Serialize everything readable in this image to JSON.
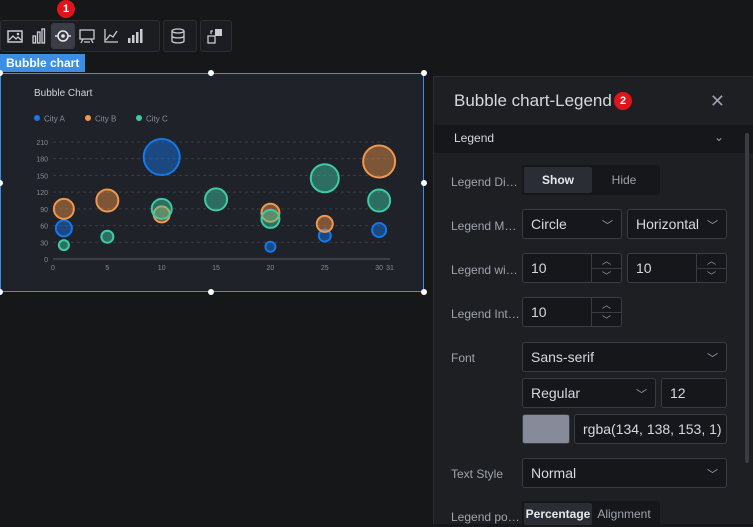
{
  "toolbar": {
    "groups": [
      [
        "image-icon",
        "bar-chart-icon",
        "bubble-target-icon",
        "dashboard-icon",
        "line-axis-icon",
        "rising-bars-icon"
      ],
      [
        "database-icon"
      ],
      [
        "link-transfer-icon"
      ]
    ],
    "active_tool": "bubble-target-icon",
    "badge_1": "1"
  },
  "canvas": {
    "tag_label": "Bubble chart"
  },
  "chart_data": {
    "type": "scatter",
    "title": "Bubble Chart",
    "legend_position": "top-left",
    "xlim": [
      0,
      31
    ],
    "ylim": [
      0,
      210
    ],
    "x_ticks": [
      "0",
      "5",
      "10",
      "15",
      "20",
      "25",
      "30",
      "31"
    ],
    "y_ticks": [
      "0",
      "30",
      "60",
      "90",
      "120",
      "150",
      "180",
      "210"
    ],
    "grid": true,
    "series": [
      {
        "name": "City A",
        "color": "#1677e8",
        "points": [
          [
            1,
            55,
            8
          ],
          [
            10,
            183,
            18
          ],
          [
            20,
            22,
            5
          ],
          [
            25,
            42,
            6
          ],
          [
            30,
            52,
            7
          ]
        ]
      },
      {
        "name": "City B",
        "color": "#f0974a",
        "points": [
          [
            1,
            90,
            10
          ],
          [
            5,
            105,
            11
          ],
          [
            10,
            80,
            8
          ],
          [
            20,
            83,
            9
          ],
          [
            25,
            63,
            8
          ],
          [
            30,
            175,
            16
          ]
        ]
      },
      {
        "name": "City C",
        "color": "#3ccba5",
        "points": [
          [
            1,
            25,
            5
          ],
          [
            5,
            40,
            6
          ],
          [
            10,
            90,
            10
          ],
          [
            15,
            107,
            11
          ],
          [
            20,
            72,
            9
          ],
          [
            25,
            145,
            14
          ],
          [
            30,
            105,
            11
          ]
        ]
      }
    ]
  },
  "panel": {
    "title": "Bubble chart-Legend",
    "badge_2": "2",
    "section": "Legend",
    "rows": {
      "legend_display_label": "Legend Display",
      "show": "Show",
      "hide": "Hide",
      "legend_mark_label": "Legend Mark",
      "mark_shape": "Circle",
      "orientation": "Horizontal",
      "legend_width_label": "Legend width",
      "width_value": "10",
      "height_value": "10",
      "legend_interval_label": "Legend Interval",
      "interval_value": "10",
      "font_label": "Font",
      "font_family": "Sans-serif",
      "font_weight": "Regular",
      "font_size": "12",
      "font_color_swatch": "#868a99",
      "font_color": "rgba(134, 138, 153, 1)",
      "text_style_label": "Text Style",
      "text_style": "Normal",
      "legend_position_label": "Legend position",
      "percentage": "Percentage",
      "alignment": "Alignment"
    }
  }
}
